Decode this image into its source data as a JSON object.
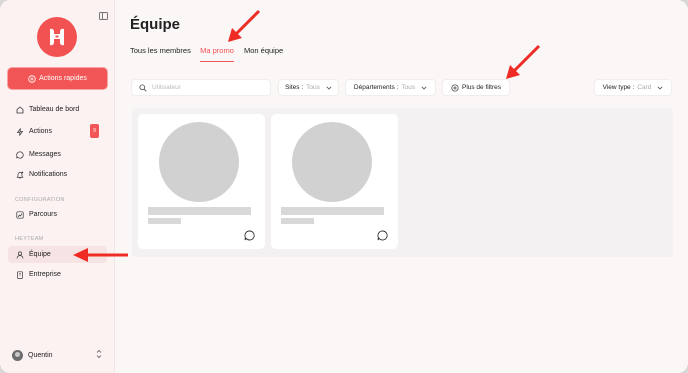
{
  "sidebar": {
    "quick_actions_label": "Actions rapides",
    "items": [
      {
        "label": "Tableau de bord",
        "icon": "home-icon"
      },
      {
        "label": "Actions",
        "icon": "bolt-icon",
        "badge": "9"
      },
      {
        "label": "Messages",
        "icon": "chat-icon"
      },
      {
        "label": "Notifications",
        "icon": "bell-icon"
      }
    ],
    "section_config": "CONFIGURATION",
    "config_items": [
      {
        "label": "Parcours",
        "icon": "chart-icon"
      }
    ],
    "section_heyteam": "HEYTEAM",
    "heyteam_items": [
      {
        "label": "Équipe",
        "icon": "person-icon",
        "active": true
      },
      {
        "label": "Entreprise",
        "icon": "building-icon"
      }
    ],
    "user_name": "Quentin"
  },
  "main": {
    "title": "Équipe",
    "tabs": [
      {
        "label": "Tous les membres"
      },
      {
        "label": "Ma promo",
        "active": true
      },
      {
        "label": "Mon équipe"
      }
    ],
    "search_placeholder": "Utilisateur",
    "filters": {
      "sites_label": "Sites :",
      "sites_value": "Tous",
      "departments_label": "Départements :",
      "departments_value": "Tous",
      "more_filters_label": "Plus de filtres",
      "view_type_label": "View type :",
      "view_type_value": "Card"
    }
  },
  "colors": {
    "accent": "#f25252",
    "annotation_arrow": "#ee2b24"
  }
}
